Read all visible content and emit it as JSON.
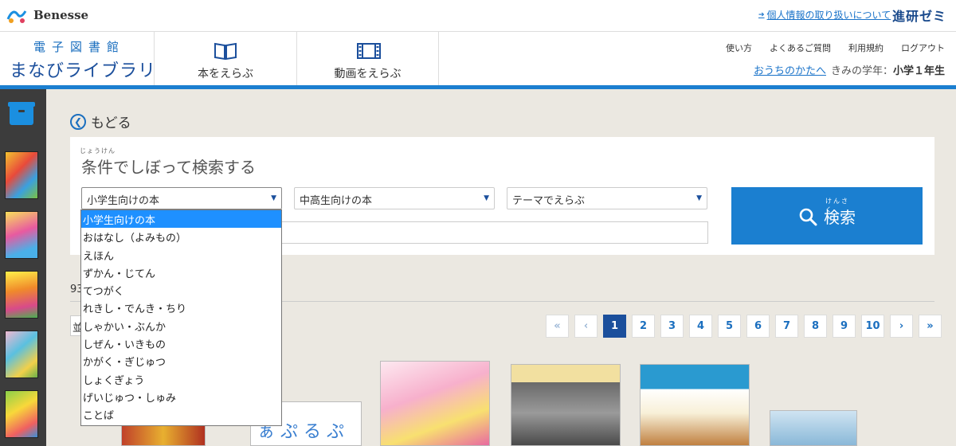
{
  "topbar": {
    "logo_text": "Benesse",
    "privacy_link": "個人情報の取り扱いについて",
    "shinken": "進研ゼミ"
  },
  "header": {
    "brand_sub": "電子図書館",
    "brand_main": "まなびライブラリー",
    "tabs": [
      {
        "label": "本をえらぶ",
        "icon": "book-icon",
        "active": true
      },
      {
        "label": "動画をえらぶ",
        "icon": "film-icon",
        "active": false
      }
    ],
    "util_links": [
      "使い方",
      "よくあるご質問",
      "利用規約",
      "ログアウト"
    ],
    "parent_link": "おうちのかたへ",
    "grade_label": "きみの学年：",
    "grade_value": "小学１年生"
  },
  "main": {
    "back_label": "もどる",
    "panel": {
      "ruby": "じょうけん",
      "title": "条件でしぼって検索する",
      "selects": [
        "小学生向けの本",
        "中高生向けの本",
        "テーマでえらぶ"
      ],
      "search_button": "検索",
      "search_ruby": "けんさく"
    },
    "count_text": "93",
    "sort_text": "並",
    "pagination": {
      "first": "«",
      "prev": "‹",
      "pages": [
        "1",
        "2",
        "3",
        "4",
        "5",
        "6",
        "7",
        "8",
        "9",
        "10"
      ],
      "current": "1",
      "next": "›",
      "last": "»"
    }
  },
  "dropdown": {
    "options": [
      "小学生向けの本",
      "おはなし（よみもの）",
      "えほん",
      "ずかん・じてん",
      "てつがく",
      "れきし・でんき・ちり",
      "しゃかい・ぶんか",
      "しぜん・いきもの",
      "かがく・ぎじゅつ",
      "しょくぎょう",
      "げいじゅつ・しゅみ",
      "ことば"
    ],
    "selected_index": 0
  },
  "colors": {
    "accent_blue": "#1b7fd0",
    "brand_navy": "#1b4f9c",
    "main_bg": "#ebe8e1",
    "sidebar_bg": "#3c3c3c",
    "dropdown_highlight": "#1e90ff"
  }
}
